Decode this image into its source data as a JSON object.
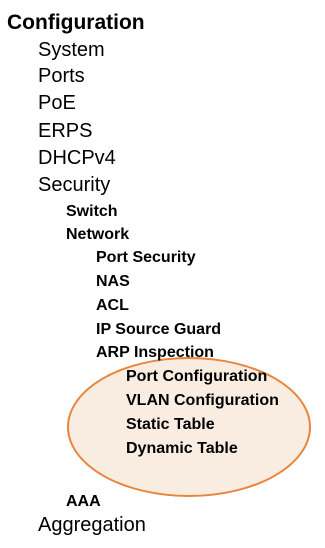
{
  "menu": {
    "root": "Configuration",
    "system": "System",
    "ports": "Ports",
    "poe": "PoE",
    "erps": "ERPS",
    "dhcpv4": "DHCPv4",
    "security": "Security",
    "switch": "Switch",
    "network": "Network",
    "port_security": "Port Security",
    "nas": "NAS",
    "acl": "ACL",
    "ip_source_guard": "IP Source Guard",
    "arp_inspection": "ARP Inspection",
    "port_configuration": "Port Configuration",
    "vlan_configuration": "VLAN Configuration",
    "static_table": "Static Table",
    "dynamic_table": "Dynamic Table",
    "aaa": "AAA",
    "aggregation": "Aggregation"
  },
  "colors": {
    "highlight_stroke": "#e8843c",
    "highlight_fill": "#f2d6bc"
  }
}
